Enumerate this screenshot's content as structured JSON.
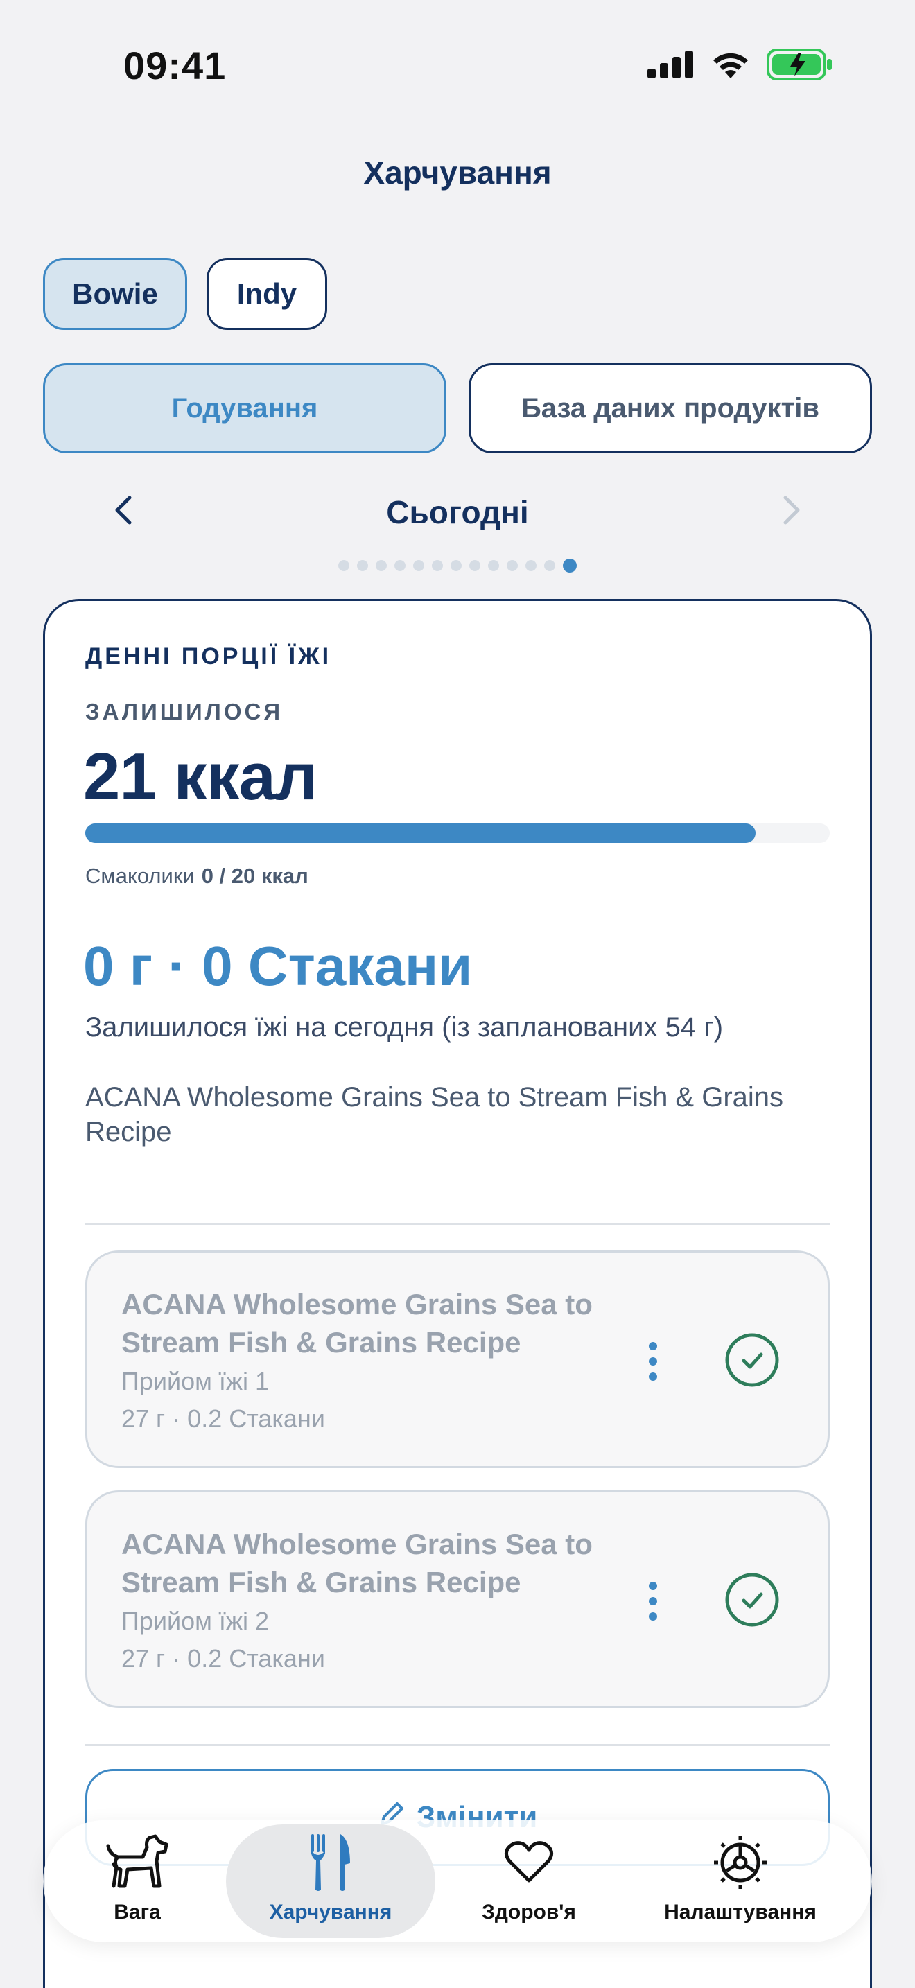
{
  "status": {
    "time": "09:41"
  },
  "header": {
    "title": "Харчування"
  },
  "pets": [
    {
      "name": "Bowie",
      "selected": true
    },
    {
      "name": "Indy",
      "selected": false
    }
  ],
  "segments": [
    {
      "label": "Годування",
      "selected": true
    },
    {
      "label": "База даних продуктів",
      "selected": false
    }
  ],
  "date_nav": {
    "label": "Сьогодні",
    "page_count": 13,
    "active_index": 12
  },
  "daily": {
    "section_title": "ДЕННІ ПОРЦІЇ ЇЖІ",
    "remaining_label": "ЗАЛИШИЛОСЯ",
    "remaining_kcal": "21 ккал",
    "progress_fraction": 0.9,
    "treats_label": "Смаколики",
    "treats_value": "0 / 20 ккал",
    "grams_cups": "0 г · 0 Стакани",
    "remaining_note": "Залишилося їжі на сегодня (із запланованих 54 г)",
    "food_name": "ACANA Wholesome Grains Sea to Stream Fish & Grains Recipe"
  },
  "meals": [
    {
      "name": "ACANA Wholesome Grains Sea to Stream Fish & Grains Recipe",
      "meal_label": "Прийом їжі 1",
      "amount": "27 г · 0.2 Стакани",
      "done": true
    },
    {
      "name": "ACANA Wholesome Grains Sea to Stream Fish & Grains Recipe",
      "meal_label": "Прийом їжі 2",
      "amount": "27 г · 0.2 Стакани",
      "done": true
    }
  ],
  "edit_button": {
    "label": "Змінити"
  },
  "tabbar": {
    "items": [
      {
        "label": "Вага",
        "icon": "dog-icon"
      },
      {
        "label": "Харчування",
        "icon": "fork-knife-icon",
        "active": true
      },
      {
        "label": "Здоров'я",
        "icon": "heart-icon"
      },
      {
        "label": "Налаштування",
        "icon": "gear-icon"
      }
    ]
  },
  "colors": {
    "primary": "#14305e",
    "accent": "#3d88c4",
    "success": "#2e7d5b",
    "background": "#f2f2f4"
  }
}
